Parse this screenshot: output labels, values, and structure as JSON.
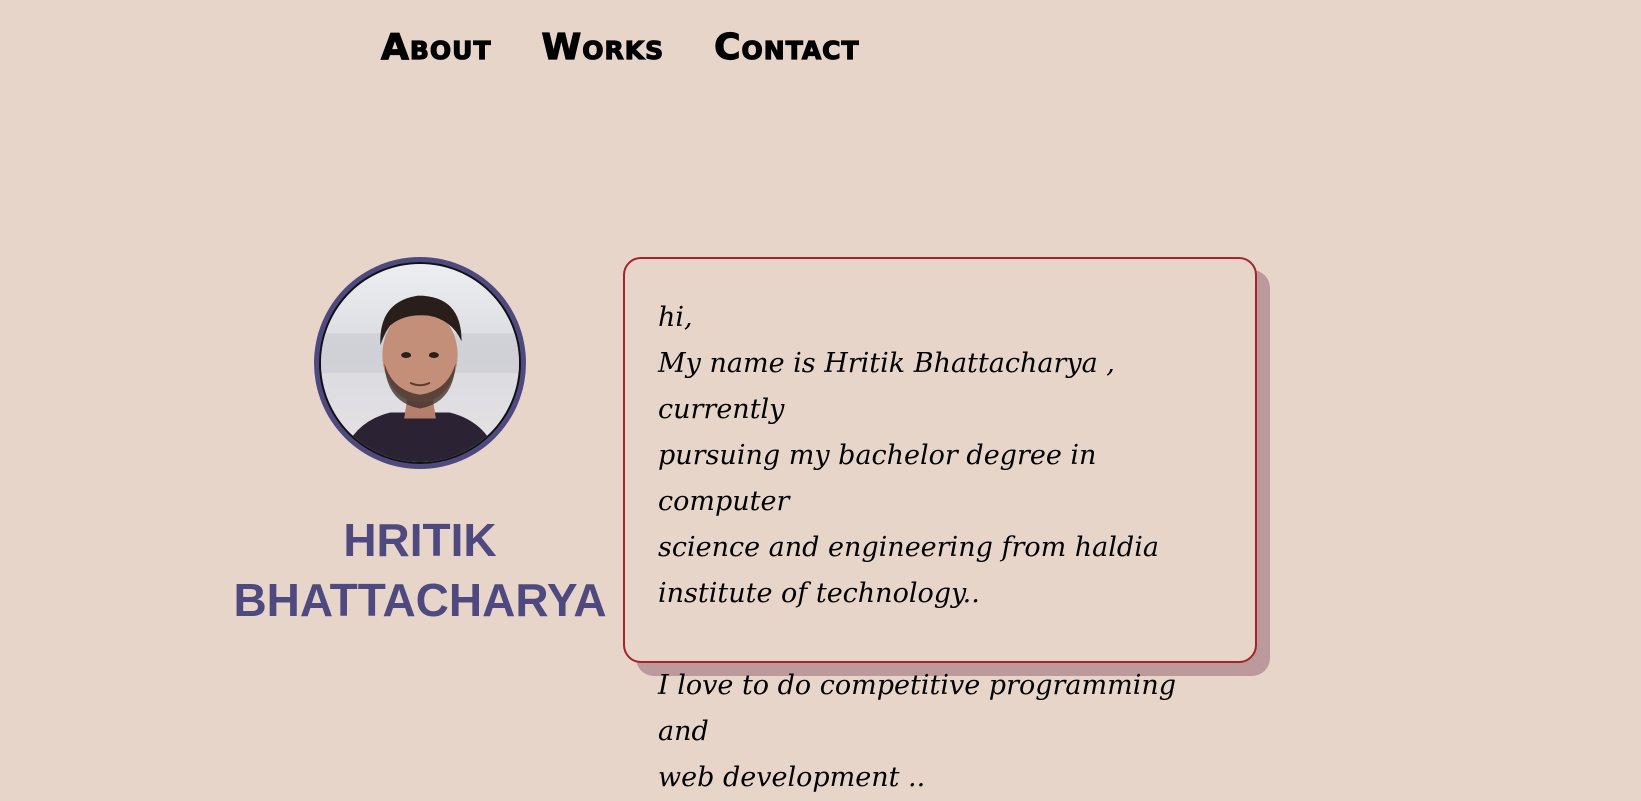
{
  "nav": {
    "items": [
      {
        "label": "About"
      },
      {
        "label": "Works"
      },
      {
        "label": "Contact"
      }
    ]
  },
  "profile": {
    "name_line1": "HRITIK",
    "name_line2": "BHATTACHARYA",
    "avatar_icon": "profile-photo"
  },
  "intro": {
    "greeting": "hi,",
    "line1": "My name is Hritik Bhattacharya , currently",
    "line2": "pursuing my bachelor degree in computer",
    "line3": "science and engineering from haldia",
    "line4": "institute of technology..",
    "line5": "I love to do competitive programming and",
    "line6": "web development .."
  },
  "colors": {
    "background": "#e8d5ca",
    "accent": "#4e4a7f",
    "card_border": "#a3252a",
    "card_shadow": "#bc9a9c"
  }
}
